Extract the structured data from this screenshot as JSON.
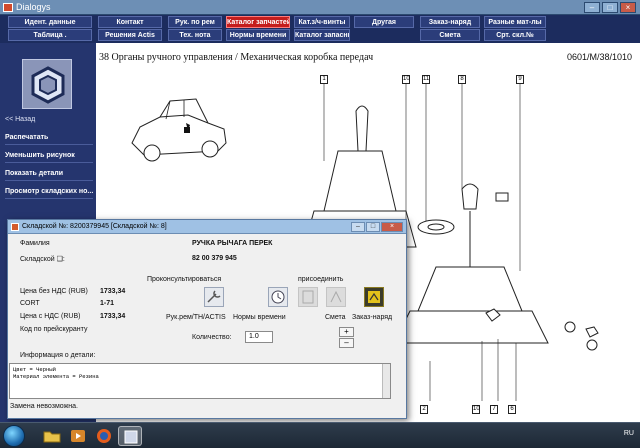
{
  "window": {
    "title": "Dialogys"
  },
  "menu": {
    "row1": [
      "Идент. данные",
      "Контакт",
      "Рук. по рем",
      "Каталог запчастей",
      "Кат.з/ч-винты",
      "Другая",
      "Заказ-наряд",
      "Разные мат-лы"
    ],
    "row2": [
      "Таблица .",
      "Решения Actis",
      "Тех. нота",
      "Нормы времени",
      "Каталог запасны...",
      "",
      "Смета",
      "Срт. скл.№"
    ],
    "active": "Каталог запчастей"
  },
  "sidebar": {
    "back": "<< Назад",
    "items": [
      "Распечатать",
      "Уменьшить рисунок",
      "Показать детали",
      "Просмотр складских но..."
    ]
  },
  "content": {
    "title": "38 Органы ручного управления / Механическая коробка передач",
    "ref": "0601/M/38/1010",
    "callouts_top": [
      "1",
      "10",
      "11",
      "8",
      "9"
    ],
    "callouts_bottom": [
      "2",
      "10",
      "7",
      "6"
    ]
  },
  "dialog": {
    "title": "Складской №: 8200379945 [Складской №: 8]",
    "family_label": "Фамилия",
    "stock_label": "Складской ❑:",
    "part_name": "РУЧКА РЫЧАГА ПЕРЕК",
    "part_number": "82 00 379 945",
    "consult_label": "Проконсультироваться",
    "attach_label": "присоединить",
    "price_no_vat_label": "Цена без НДС (RUB)",
    "price_no_vat": "1733,34",
    "cort_label": "CORT",
    "cort_value": "1-71",
    "price_vat_label": "Цена с НДС (RUB)",
    "price_vat": "1733,34",
    "code_label": "Код по прейскуранту",
    "actions": [
      "Рук.рем/TH/ACTIS",
      "Нормы времени",
      "Смета",
      "Заказ-наряд"
    ],
    "qty_label": "Количество:",
    "qty_value": "1.0",
    "info_label": "Информация о детали:",
    "info_lines": [
      "Цвет = Черный",
      "Материал элемента = Резина"
    ],
    "status": "Замена невозможна."
  },
  "taskbar": {
    "time": "RU"
  },
  "colors": {
    "menu_bg": "#1c2c5e",
    "active_tab": "#c41d1d",
    "sidebar_bg": "#25356e"
  }
}
